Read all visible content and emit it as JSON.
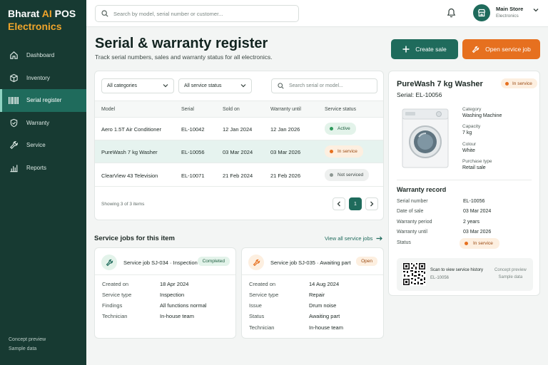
{
  "brand": {
    "name_prefix": "Bharat ",
    "name_ai": "AI",
    "name_suffix": " POS",
    "line2": "Electronics"
  },
  "sidebar": {
    "items": [
      {
        "label": "Dashboard",
        "icon": "home-icon"
      },
      {
        "label": "Inventory",
        "icon": "box-icon"
      },
      {
        "label": "Serial register",
        "icon": "barcode-icon",
        "active": true
      },
      {
        "label": "Warranty",
        "icon": "shield-check-icon"
      },
      {
        "label": "Service",
        "icon": "wrench-icon"
      },
      {
        "label": "Reports",
        "icon": "bar-chart-icon"
      }
    ],
    "footer": {
      "line1": "Concept preview",
      "line2": "Sample data"
    }
  },
  "topbar": {
    "search_placeholder": "Search by model, serial number or customer...",
    "store_name": "Main Store",
    "store_sub": "Electronics"
  },
  "page": {
    "title": "Serial & warranty register",
    "subtitle": "Track serial numbers, sales and warranty status for all electronics.",
    "create_sale": "Create sale",
    "open_service_job": "Open service job"
  },
  "filters": {
    "category": "All categories",
    "service_status": "All service status",
    "search_placeholder": "Search serial or model..."
  },
  "table": {
    "headers": [
      "Model",
      "Serial",
      "Sold on",
      "Warranty until",
      "Service status"
    ],
    "rows": [
      {
        "model": "Aero 1.5T Air Conditioner",
        "serial": "EL-10042",
        "sold": "12 Jan 2024",
        "warranty": "12 Jan 2026",
        "status": "Active"
      },
      {
        "model": "PureWash 7 kg Washer",
        "serial": "EL-10056",
        "sold": "03 Mar 2024",
        "warranty": "03 Mar 2026",
        "status": "In service"
      },
      {
        "model": "ClearView 43 Television",
        "serial": "EL-10071",
        "sold": "21 Feb 2024",
        "warranty": "21 Feb 2026",
        "status": "Not serviced"
      }
    ],
    "showing": "Showing 3 of 3 items",
    "page": "1"
  },
  "service_jobs": {
    "title": "Service jobs for this item",
    "view_all": "View all service jobs",
    "jobs": [
      {
        "title": "Service job SJ-034 · Inspection",
        "badge": "Completed",
        "fields": [
          [
            "Created on",
            "18 Apr 2024"
          ],
          [
            "Service type",
            "Inspection"
          ],
          [
            "Findings",
            "All functions normal"
          ],
          [
            "Technician",
            "In-house team"
          ]
        ]
      },
      {
        "title": "Service job SJ-035 · Awaiting part",
        "badge": "Open",
        "fields": [
          [
            "Created on",
            "14 Aug 2024"
          ],
          [
            "Service type",
            "Repair"
          ],
          [
            "Issue",
            "Drum noise"
          ],
          [
            "Status",
            "Awaiting part"
          ],
          [
            "Technician",
            "In-house team"
          ]
        ]
      }
    ]
  },
  "detail": {
    "name": "PureWash 7 kg Washer",
    "serial": "Serial: EL-10056",
    "badge": "In service",
    "specs": [
      [
        "Category",
        "Washing Machine"
      ],
      [
        "Capacity",
        "7 kg"
      ],
      [
        "Colour",
        "White"
      ],
      [
        "Purchase type",
        "Retail sale"
      ]
    ],
    "warranty_title": "Warranty record",
    "warranty": [
      [
        "Serial number",
        "EL-10056"
      ],
      [
        "Date of sale",
        "03 Mar 2024"
      ],
      [
        "Warranty period",
        "2 years"
      ],
      [
        "Warranty until",
        "03 Mar 2026"
      ]
    ],
    "status_label": "Status",
    "status_value": "In service",
    "qr_title": "Scan to view service history",
    "qr_serial": "EL-10056",
    "qr_caption1": "Concept preview",
    "qr_caption2": "Sample data"
  },
  "colors": {
    "primary": "#1f6b5c",
    "accent": "#e6701f",
    "sidebar": "#173a32"
  }
}
